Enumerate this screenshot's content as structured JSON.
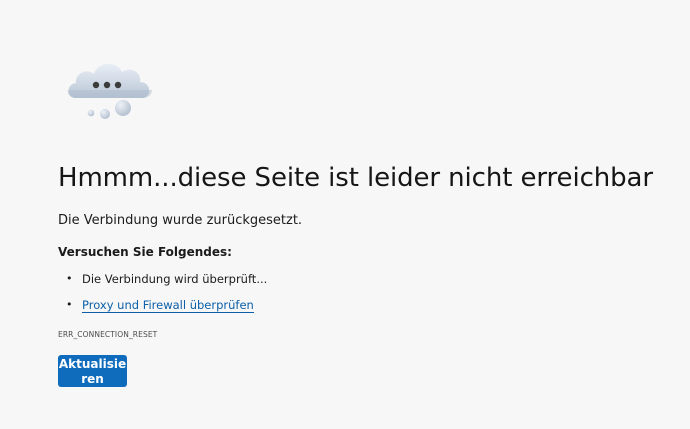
{
  "page": {
    "headline": "Hmmm...diese Seite ist leider nicht erreichbar",
    "subtitle": "Die Verbindung wurde zurückgesetzt.",
    "suggestions_title": "Versuchen Sie Folgendes:",
    "suggestions": [
      {
        "label": "Die Verbindung wird überprüft...",
        "is_link": false
      },
      {
        "label": "Proxy und Firewall überprüfen",
        "is_link": true
      }
    ],
    "error_code": "ERR_CONNECTION_RESET",
    "refresh_button_label": "Aktualisieren"
  },
  "icons": {
    "illustration": "thinking-cloud-icon"
  },
  "colors": {
    "background": "#f7f7f7",
    "accent": "#0f6cbd",
    "link": "#0c5fa8",
    "text": "#1b1b1b"
  }
}
